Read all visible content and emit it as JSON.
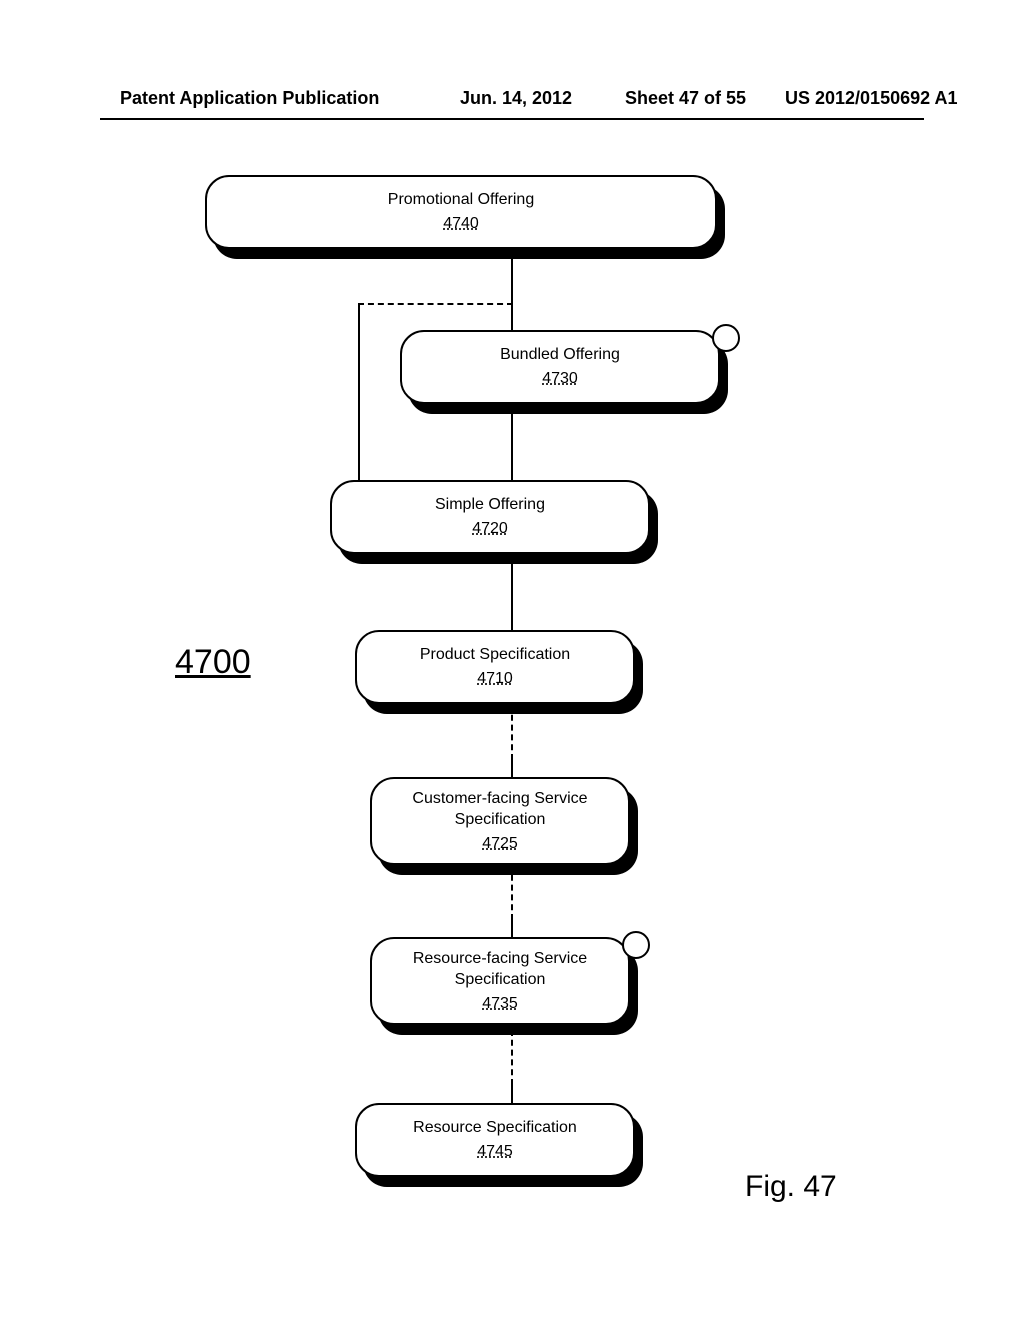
{
  "header": {
    "publication": "Patent Application Publication",
    "date": "Jun. 14, 2012",
    "sheet": "Sheet 47 of 55",
    "docnum": "US 2012/0150692 A1"
  },
  "diagram": {
    "overall_ref": "4700",
    "fig_label": "Fig. 47",
    "boxes": {
      "b4740": {
        "title": "Promotional Offering",
        "ref": "4740"
      },
      "b4730": {
        "title": "Bundled Offering",
        "ref": "4730"
      },
      "b4720": {
        "title": "Simple Offering",
        "ref": "4720"
      },
      "b4710": {
        "title": "Product Specification",
        "ref": "4710"
      },
      "b4725": {
        "title": "Customer-facing Service Specification",
        "ref": "4725"
      },
      "b4735": {
        "title": "Resource-facing Service Specification",
        "ref": "4735"
      },
      "b4745": {
        "title": "Resource Specification",
        "ref": "4745"
      }
    }
  }
}
